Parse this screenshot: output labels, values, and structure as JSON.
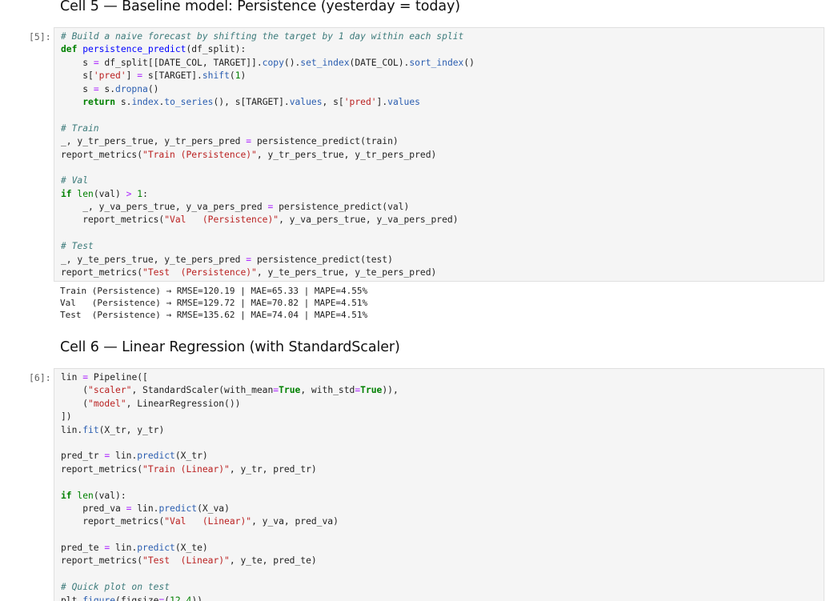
{
  "cells": [
    {
      "heading": "Cell 5 — Baseline model: Persistence (yesterday = today)",
      "prompt": "[5]:",
      "code_lines": [
        [
          [
            "cm",
            "# Build a naive forecast by shifting the target by 1 day within each split"
          ]
        ],
        [
          [
            "kw",
            "def"
          ],
          [
            "p",
            " "
          ],
          [
            "fn",
            "persistence_predict"
          ],
          [
            "p",
            "(df_split):"
          ]
        ],
        [
          [
            "p",
            "    s "
          ],
          [
            "op",
            "="
          ],
          [
            "p",
            " df_split[[DATE_COL, TARGET]]."
          ],
          [
            "mt",
            "copy"
          ],
          [
            "p",
            "()."
          ],
          [
            "mt",
            "set_index"
          ],
          [
            "p",
            "(DATE_COL)."
          ],
          [
            "mt",
            "sort_index"
          ],
          [
            "p",
            "()"
          ]
        ],
        [
          [
            "p",
            "    s["
          ],
          [
            "str",
            "'pred'"
          ],
          [
            "p",
            "] "
          ],
          [
            "op",
            "="
          ],
          [
            "p",
            " s[TARGET]."
          ],
          [
            "mt",
            "shift"
          ],
          [
            "p",
            "("
          ],
          [
            "num",
            "1"
          ],
          [
            "p",
            ")"
          ]
        ],
        [
          [
            "p",
            "    s "
          ],
          [
            "op",
            "="
          ],
          [
            "p",
            " s."
          ],
          [
            "mt",
            "dropna"
          ],
          [
            "p",
            "()"
          ]
        ],
        [
          [
            "p",
            "    "
          ],
          [
            "kw",
            "return"
          ],
          [
            "p",
            " s."
          ],
          [
            "mt",
            "index"
          ],
          [
            "p",
            "."
          ],
          [
            "mt",
            "to_series"
          ],
          [
            "p",
            "(), s[TARGET]."
          ],
          [
            "mt",
            "values"
          ],
          [
            "p",
            ", s["
          ],
          [
            "str",
            "'pred'"
          ],
          [
            "p",
            "]."
          ],
          [
            "mt",
            "values"
          ]
        ],
        [],
        [
          [
            "cm",
            "# Train"
          ]
        ],
        [
          [
            "p",
            "_, y_tr_pers_true, y_tr_pers_pred "
          ],
          [
            "op",
            "="
          ],
          [
            "p",
            " persistence_predict(train)"
          ]
        ],
        [
          [
            "p",
            "report_metrics("
          ],
          [
            "str",
            "\"Train (Persistence)\""
          ],
          [
            "p",
            ", y_tr_pers_true, y_tr_pers_pred)"
          ]
        ],
        [],
        [
          [
            "cm",
            "# Val"
          ]
        ],
        [
          [
            "kw",
            "if"
          ],
          [
            "p",
            " "
          ],
          [
            "bi",
            "len"
          ],
          [
            "p",
            "(val) "
          ],
          [
            "op",
            ">"
          ],
          [
            "p",
            " "
          ],
          [
            "num",
            "1"
          ],
          [
            "p",
            ":"
          ]
        ],
        [
          [
            "p",
            "    _, y_va_pers_true, y_va_pers_pred "
          ],
          [
            "op",
            "="
          ],
          [
            "p",
            " persistence_predict(val)"
          ]
        ],
        [
          [
            "p",
            "    report_metrics("
          ],
          [
            "str",
            "\"Val   (Persistence)\""
          ],
          [
            "p",
            ", y_va_pers_true, y_va_pers_pred)"
          ]
        ],
        [],
        [
          [
            "cm",
            "# Test"
          ]
        ],
        [
          [
            "p",
            "_, y_te_pers_true, y_te_pers_pred "
          ],
          [
            "op",
            "="
          ],
          [
            "p",
            " persistence_predict(test)"
          ]
        ],
        [
          [
            "p",
            "report_metrics("
          ],
          [
            "str",
            "\"Test  (Persistence)\""
          ],
          [
            "p",
            ", y_te_pers_true, y_te_pers_pred)"
          ]
        ]
      ],
      "output_lines": [
        "Train (Persistence) → RMSE=120.19 | MAE=65.33 | MAPE=4.55%",
        "Val   (Persistence) → RMSE=129.72 | MAE=70.82 | MAPE=4.51%",
        "Test  (Persistence) → RMSE=135.62 | MAE=74.04 | MAPE=4.51%"
      ]
    },
    {
      "heading": "Cell 6 — Linear Regression (with StandardScaler)",
      "prompt": "[6]:",
      "code_lines": [
        [
          [
            "p",
            "lin "
          ],
          [
            "op",
            "="
          ],
          [
            "p",
            " Pipeline(["
          ]
        ],
        [
          [
            "p",
            "    ("
          ],
          [
            "str",
            "\"scaler\""
          ],
          [
            "p",
            ", StandardScaler(with_mean"
          ],
          [
            "op",
            "="
          ],
          [
            "kw",
            "True"
          ],
          [
            "p",
            ", with_std"
          ],
          [
            "op",
            "="
          ],
          [
            "kw",
            "True"
          ],
          [
            "p",
            ")),"
          ]
        ],
        [
          [
            "p",
            "    ("
          ],
          [
            "str",
            "\"model\""
          ],
          [
            "p",
            ", LinearRegression())"
          ]
        ],
        [
          [
            "p",
            "])"
          ]
        ],
        [
          [
            "p",
            "lin."
          ],
          [
            "mt",
            "fit"
          ],
          [
            "p",
            "(X_tr, y_tr)"
          ]
        ],
        [],
        [
          [
            "p",
            "pred_tr "
          ],
          [
            "op",
            "="
          ],
          [
            "p",
            " lin."
          ],
          [
            "mt",
            "predict"
          ],
          [
            "p",
            "(X_tr)"
          ]
        ],
        [
          [
            "p",
            "report_metrics("
          ],
          [
            "str",
            "\"Train (Linear)\""
          ],
          [
            "p",
            ", y_tr, pred_tr)"
          ]
        ],
        [],
        [
          [
            "kw",
            "if"
          ],
          [
            "p",
            " "
          ],
          [
            "bi",
            "len"
          ],
          [
            "p",
            "(val):"
          ]
        ],
        [
          [
            "p",
            "    pred_va "
          ],
          [
            "op",
            "="
          ],
          [
            "p",
            " lin."
          ],
          [
            "mt",
            "predict"
          ],
          [
            "p",
            "(X_va)"
          ]
        ],
        [
          [
            "p",
            "    report_metrics("
          ],
          [
            "str",
            "\"Val   (Linear)\""
          ],
          [
            "p",
            ", y_va, pred_va)"
          ]
        ],
        [],
        [
          [
            "p",
            "pred_te "
          ],
          [
            "op",
            "="
          ],
          [
            "p",
            " lin."
          ],
          [
            "mt",
            "predict"
          ],
          [
            "p",
            "(X_te)"
          ]
        ],
        [
          [
            "p",
            "report_metrics("
          ],
          [
            "str",
            "\"Test  (Linear)\""
          ],
          [
            "p",
            ", y_te, pred_te)"
          ]
        ],
        [],
        [
          [
            "cm",
            "# Quick plot on test"
          ]
        ],
        [
          [
            "p",
            "plt."
          ],
          [
            "mt",
            "figure"
          ],
          [
            "p",
            "(figsize"
          ],
          [
            "op",
            "="
          ],
          [
            "p",
            "("
          ],
          [
            "num",
            "12"
          ],
          [
            "p",
            ","
          ],
          [
            "num",
            "4"
          ],
          [
            "p",
            "))"
          ]
        ]
      ],
      "output_lines": []
    }
  ]
}
